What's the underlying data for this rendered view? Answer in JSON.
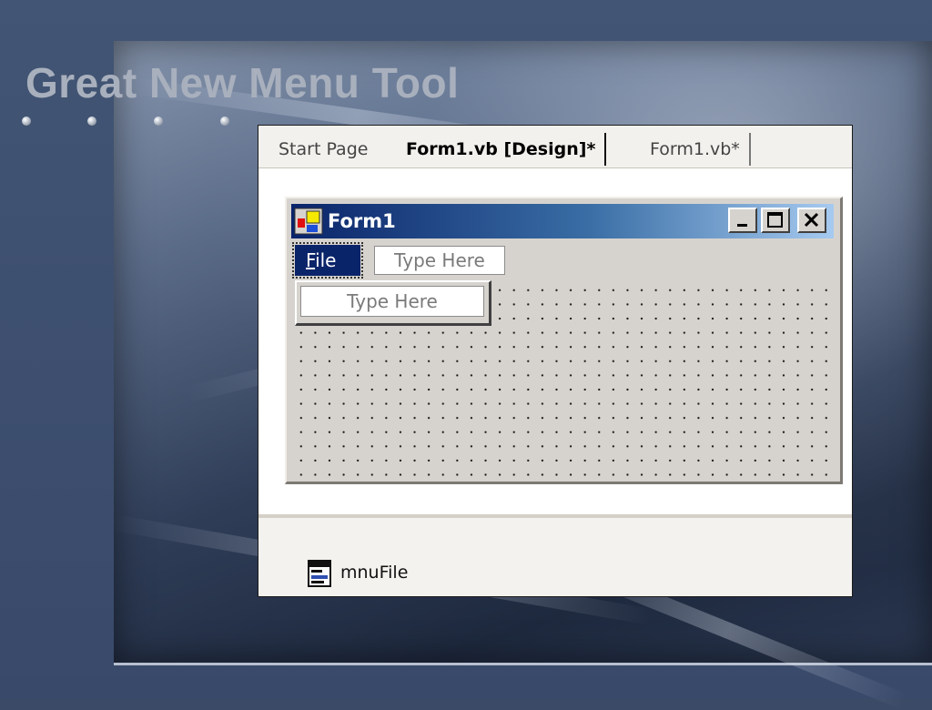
{
  "slide": {
    "title": "Great New Menu Tool"
  },
  "ide": {
    "tabs": [
      {
        "label": "Start Page"
      },
      {
        "label": "Form1.vb [Design]*"
      },
      {
        "label": "Form1.vb*"
      }
    ],
    "form": {
      "title": "Form1",
      "menu": {
        "file_label_accel": "F",
        "file_label_rest": "ile",
        "type_here_top": "Type Here",
        "type_here_dropdown": "Type Here"
      }
    },
    "tray": {
      "component_label": "mnuFile"
    }
  },
  "colors": {
    "titlebar_start": "#0a246a",
    "titlebar_end": "#a6caf0",
    "form_face": "#d6d3ce",
    "slide_title": "#a9b0bd"
  },
  "icons": [
    "form-app-icon",
    "minimize-icon",
    "maximize-icon",
    "close-icon",
    "menu-component-icon"
  ]
}
